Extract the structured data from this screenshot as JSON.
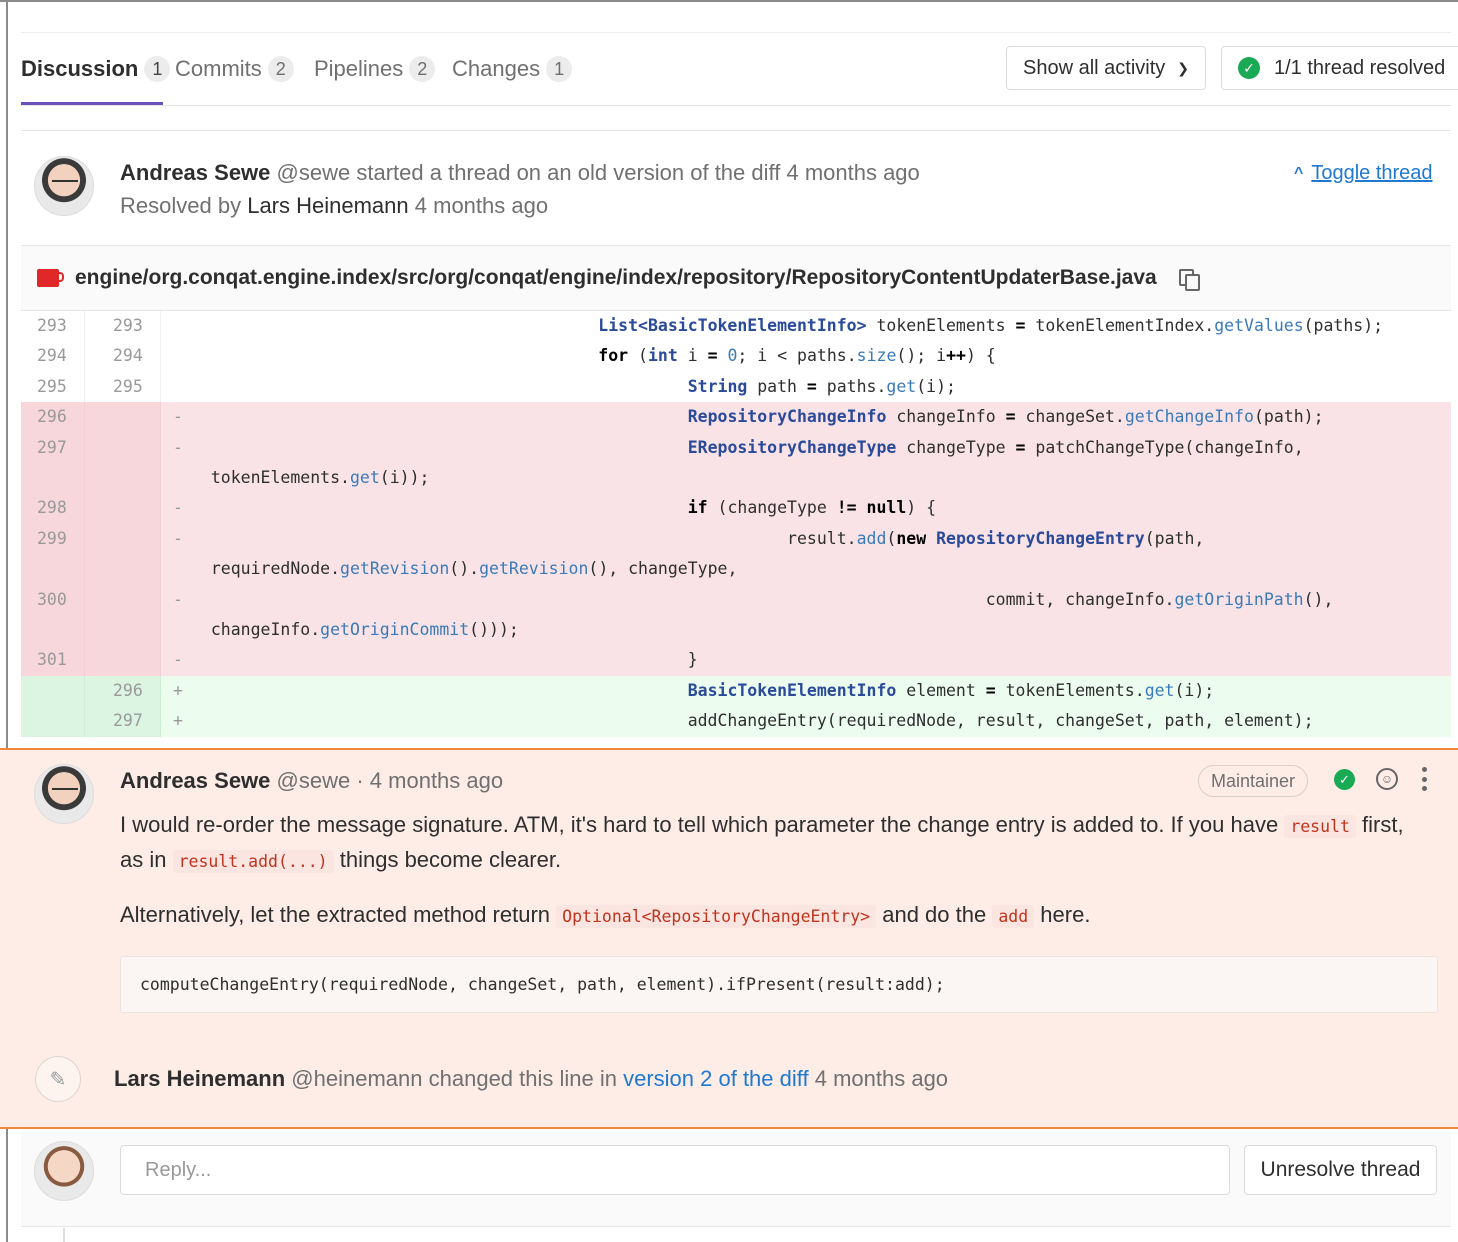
{
  "tabs": [
    {
      "label": "Discussion",
      "count": "1"
    },
    {
      "label": "Commits",
      "count": "2"
    },
    {
      "label": "Pipelines",
      "count": "2"
    },
    {
      "label": "Changes",
      "count": "1"
    }
  ],
  "activity_filter": "Show all activity",
  "thread_status": "1/1 thread resolved",
  "thread": {
    "author": "Andreas Sewe",
    "handle": "@sewe",
    "action": "started a thread on an old version of the diff",
    "time": "4 months ago",
    "resolved_prefix": "Resolved by",
    "resolved_by": "Lars Heinemann",
    "resolved_time": "4 months ago",
    "toggle_label": "Toggle thread"
  },
  "file": {
    "path": "engine/org.conqat.engine.index/src/org/conqat/engine/index/repository/RepositoryContentUpdaterBase.java"
  },
  "diff_line_numbers": {
    "r293a": "293",
    "r293b": "293",
    "r294a": "294",
    "r294b": "294",
    "r295a": "295",
    "r295b": "295",
    "r296": "296",
    "r297": "297",
    "r298": "298",
    "r299": "299",
    "r300": "300",
    "r301": "301",
    "n296": "296",
    "n297": "297"
  },
  "note": {
    "author": "Andreas Sewe",
    "handle": "@sewe",
    "time": "· 4 months ago",
    "role": "Maintainer",
    "p1_a": "I would re-order the message signature. ATM, it's hard to tell which parameter the change entry is added to. If you have",
    "p1_code1": "result",
    "p1_b": "first, as in",
    "p1_code2": "result.add(...)",
    "p1_c": "things become clearer.",
    "p2_a": "Alternatively, let the extracted method return",
    "p2_code1": "Optional<RepositoryChangeEntry>",
    "p2_b": "and do the",
    "p2_code2": "add",
    "p2_c": "here.",
    "code_block": "computeChangeEntry(requiredNode, changeSet, path, element).ifPresent(result:add);"
  },
  "system_note": {
    "author": "Lars Heinemann",
    "handle": "@heinemann",
    "action": "changed this line in",
    "link": "version 2 of the diff",
    "time": "4 months ago"
  },
  "reply": {
    "placeholder": "Reply...",
    "unresolve_label": "Unresolve thread"
  },
  "colors": {
    "accent": "#6b4fbb",
    "resolved": "#1aaa55",
    "link": "#1f78d1",
    "highlight_border": "#f0883e",
    "highlight_bg": "#feede6"
  }
}
